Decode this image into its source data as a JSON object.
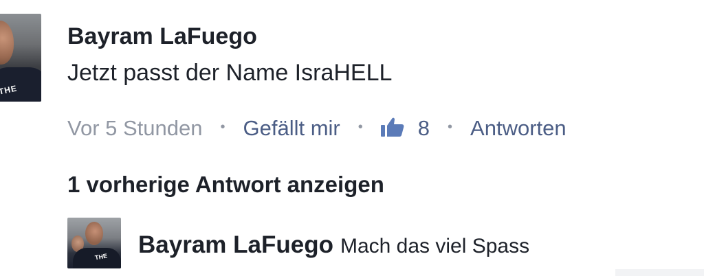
{
  "comment": {
    "author": "Bayram LaFuego",
    "text": "Jetzt passt der Name IsraHELL",
    "avatar_shirt_print": "THE",
    "meta": {
      "time": "Vor 5 Stunden",
      "separator": "•",
      "like_label": "Gefällt mir",
      "like_count": "8",
      "reply_label": "Antworten",
      "like_icon": "thumbs-up-icon",
      "link_color": "#4b5d85",
      "muted_color": "#9197a3"
    }
  },
  "previous_replies": {
    "label": "1 vorherige Antwort anzeigen"
  },
  "reply": {
    "author": "Bayram LaFuego",
    "text": "Mach das viel Spass",
    "avatar_shirt_print": "THE"
  }
}
